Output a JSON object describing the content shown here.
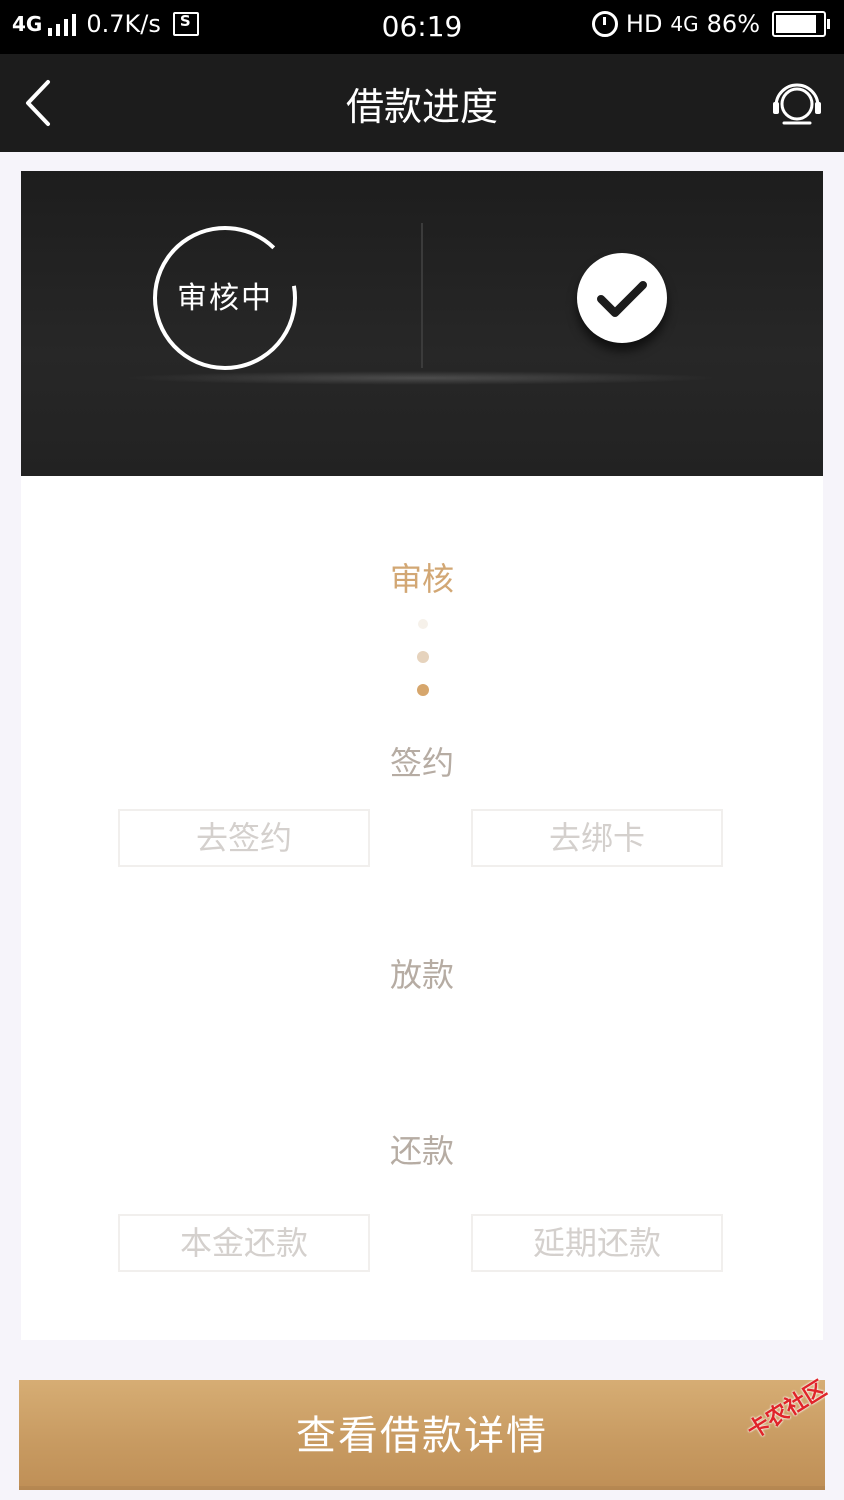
{
  "status_bar": {
    "network": "4G",
    "speed": "0.7K/s",
    "time": "06:19",
    "hd": "HD",
    "network_right": "4G",
    "battery": "86%"
  },
  "header": {
    "title": "借款进度",
    "back_icon": "chevron-left-icon",
    "service_icon": "headset-icon"
  },
  "status_card": {
    "ring_label": "审核中",
    "ring_progress": 0.9,
    "check_icon": "check-circle-icon"
  },
  "steps": [
    {
      "label": "审核",
      "active": true
    },
    {
      "label": "签约",
      "active": false
    },
    {
      "label": "放款",
      "active": false
    },
    {
      "label": "还款",
      "active": false
    }
  ],
  "sign_actions": [
    "去签约",
    "去绑卡"
  ],
  "repay_actions": [
    "本金还款",
    "延期还款"
  ],
  "primary_button": "查看借款详情",
  "watermark": "卡农社区",
  "colors": {
    "accent_gold": "#d2a774",
    "button_gold": "#c89b62",
    "header_bg": "#1c1c1c",
    "muted_text": "#b6aca3"
  }
}
